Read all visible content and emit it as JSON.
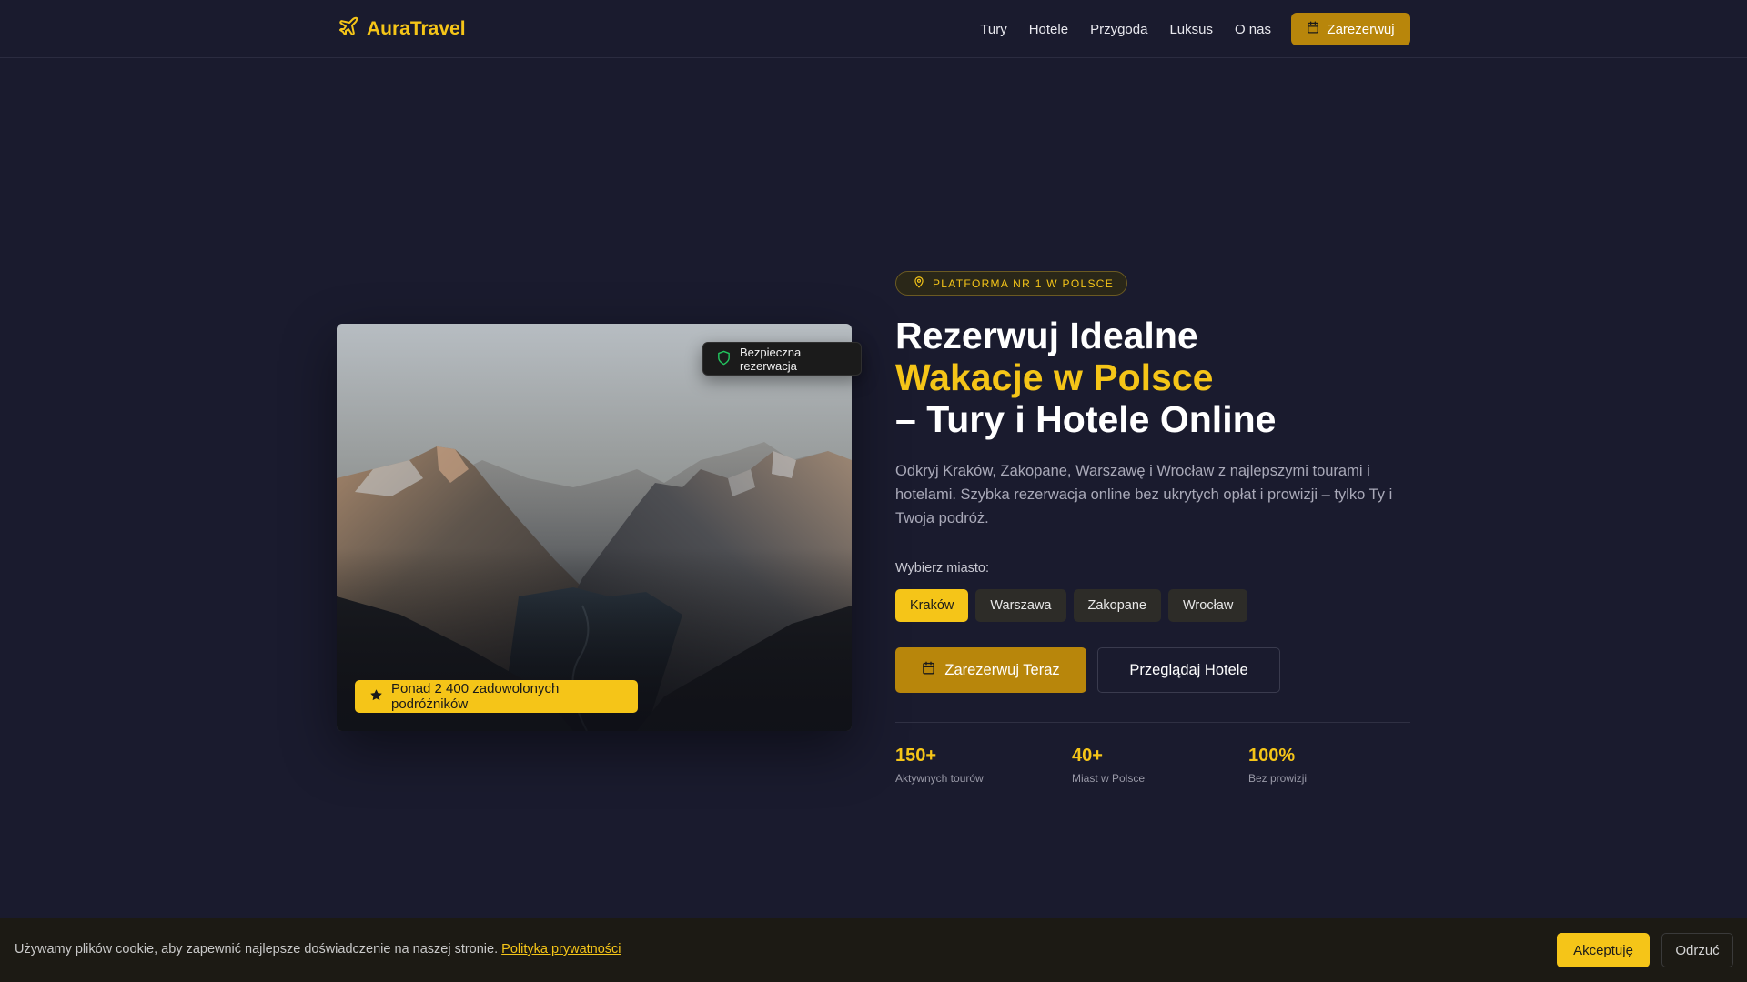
{
  "brand": {
    "name": "AuraTravel",
    "icon": "plane-icon",
    "color": "#f5c518"
  },
  "nav": {
    "links": [
      "Tury",
      "Hotele",
      "Przygoda",
      "Luksus",
      "O nas"
    ],
    "cta": {
      "label": "Zarezerwuj",
      "icon": "calendar-icon"
    }
  },
  "hero": {
    "pill": {
      "label": "PLATFORMA NR 1 W POLSCE",
      "icon": "map-pin-icon"
    },
    "headline": {
      "line1": "Rezerwuj Idealne",
      "line2": "Wakacje w Polsce",
      "line3": "– Tury i Hotele Online"
    },
    "description": "Odkryj Kraków, Zakopane, Warszawę i Wrocław z najlepszymi tourami i hotelami. Szybka rezerwacja online bez ukrytych opłat i prowizji – tylko Ty i Twoja podróż.",
    "choose_label": "Wybierz miasto:",
    "cities": [
      {
        "label": "Kraków",
        "selected": true
      },
      {
        "label": "Warszawa",
        "selected": false
      },
      {
        "label": "Zakopane",
        "selected": false
      },
      {
        "label": "Wrocław",
        "selected": false
      }
    ],
    "primary_button": {
      "label": "Zarezerwuj Teraz",
      "icon": "calendar-icon"
    },
    "secondary_button": {
      "label": "Przeglądaj Hotele"
    },
    "stats": [
      {
        "value": "150+",
        "label": "Aktywnych tourów"
      },
      {
        "value": "40+",
        "label": "Miast w Polsce"
      },
      {
        "value": "100%",
        "label": "Bez prowizji"
      }
    ],
    "image": {
      "secure_badge": {
        "label": "Bezpieczna rezerwacja",
        "icon": "shield-icon",
        "icon_color": "#22c55e"
      },
      "travelers_badge": {
        "label": "Ponad 2 400 zadowolonych podróżników",
        "icon": "star-icon"
      }
    }
  },
  "cookie": {
    "text": "Używamy plików cookie, aby zapewnić najlepsze doświadczenie na naszej stronie.",
    "link": "Polityka prywatności",
    "accept": "Akceptuję",
    "decline": "Odrzuć"
  },
  "colors": {
    "background": "#1a1b2e",
    "accent": "#f5c518",
    "accent_dark": "#b8860b"
  }
}
